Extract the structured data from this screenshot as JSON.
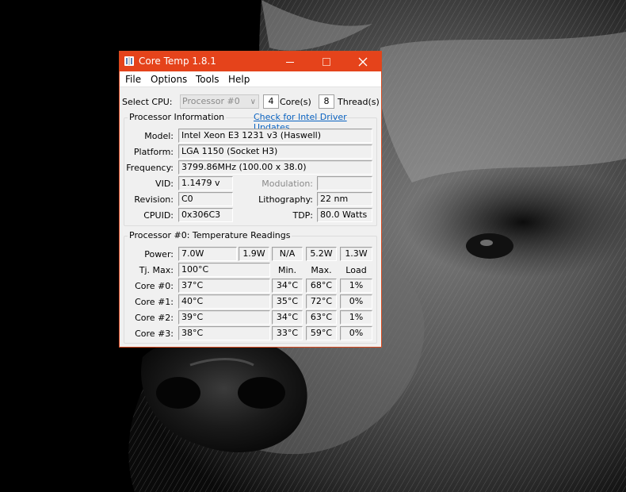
{
  "window": {
    "title": "Core Temp 1.8.1"
  },
  "menu": [
    "File",
    "Options",
    "Tools",
    "Help"
  ],
  "select_cpu": {
    "label": "Select CPU:",
    "value": "Processor #0",
    "cores_value": "4",
    "cores_label": "Core(s)",
    "threads_value": "8",
    "threads_label": "Thread(s)"
  },
  "processor_info": {
    "group_title": "Processor Information",
    "driver_link": "Check for Intel Driver Updates",
    "model_label": "Model:",
    "model": "Intel Xeon E3 1231 v3 (Haswell)",
    "platform_label": "Platform:",
    "platform": "LGA 1150 (Socket H3)",
    "frequency_label": "Frequency:",
    "frequency": "3799.86MHz (100.00 x 38.0)",
    "vid_label": "VID:",
    "vid": "1.1479 v",
    "modulation_label": "Modulation:",
    "modulation": "",
    "revision_label": "Revision:",
    "revision": "C0",
    "lithography_label": "Lithography:",
    "lithography": "22 nm",
    "cpuid_label": "CPUID:",
    "cpuid": "0x306C3",
    "tdp_label": "TDP:",
    "tdp": "80.0 Watts"
  },
  "temps": {
    "group_title": "Processor #0: Temperature Readings",
    "power_label": "Power:",
    "power": [
      "7.0W",
      "1.9W",
      "N/A",
      "5.2W",
      "1.3W"
    ],
    "tjmax_label": "Tj. Max:",
    "tjmax": "100°C",
    "col_min": "Min.",
    "col_max": "Max.",
    "col_load": "Load",
    "cores": [
      {
        "label": "Core #0:",
        "temp": "37°C",
        "min": "34°C",
        "max": "68°C",
        "load": "1%"
      },
      {
        "label": "Core #1:",
        "temp": "40°C",
        "min": "35°C",
        "max": "72°C",
        "load": "0%"
      },
      {
        "label": "Core #2:",
        "temp": "39°C",
        "min": "34°C",
        "max": "63°C",
        "load": "1%"
      },
      {
        "label": "Core #3:",
        "temp": "38°C",
        "min": "33°C",
        "max": "59°C",
        "load": "0%"
      }
    ]
  },
  "colors": {
    "titlebar": "#e5431b",
    "link": "#0b63c1",
    "window_bg": "#f0f0f0"
  },
  "icons": {
    "app": "core-temp-app-icon",
    "minimize": "minimize-icon",
    "maximize": "maximize-icon",
    "close": "close-icon",
    "dropdown": "chevron-down-icon"
  }
}
